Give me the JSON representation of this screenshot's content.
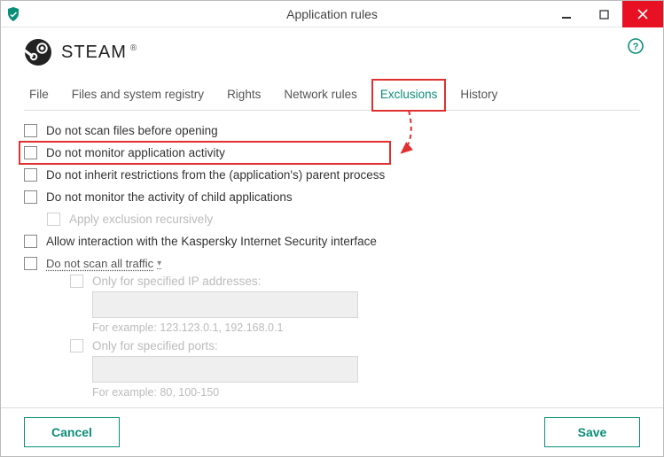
{
  "window": {
    "title": "Application rules"
  },
  "brand": {
    "name": "STEAM"
  },
  "tabs": [
    {
      "label": "File"
    },
    {
      "label": "Files and system registry"
    },
    {
      "label": "Rights"
    },
    {
      "label": "Network rules"
    },
    {
      "label": "Exclusions"
    },
    {
      "label": "History"
    }
  ],
  "options": {
    "no_scan_before_open": "Do not scan files before opening",
    "no_monitor_activity": "Do not monitor application activity",
    "no_inherit_restrictions": "Do not inherit restrictions from the (application's) parent process",
    "no_monitor_child": "Do not monitor the activity of child applications",
    "apply_recursive": "Apply exclusion recursively",
    "allow_kis_interaction": "Allow interaction with the Kaspersky Internet Security interface",
    "no_scan_all_traffic": "Do not scan all traffic",
    "caret": "▾",
    "only_ip": {
      "label": "Only for specified IP addresses:",
      "value": "",
      "hint": "For example: 123.123.0.1, 192.168.0.1"
    },
    "only_ports": {
      "label": "Only for specified ports:",
      "value": "",
      "hint": "For example: 80, 100-150"
    }
  },
  "buttons": {
    "cancel": "Cancel",
    "save": "Save"
  },
  "colors": {
    "accent": "#0a8f78",
    "highlight": "#e03030",
    "close": "#e81123"
  }
}
